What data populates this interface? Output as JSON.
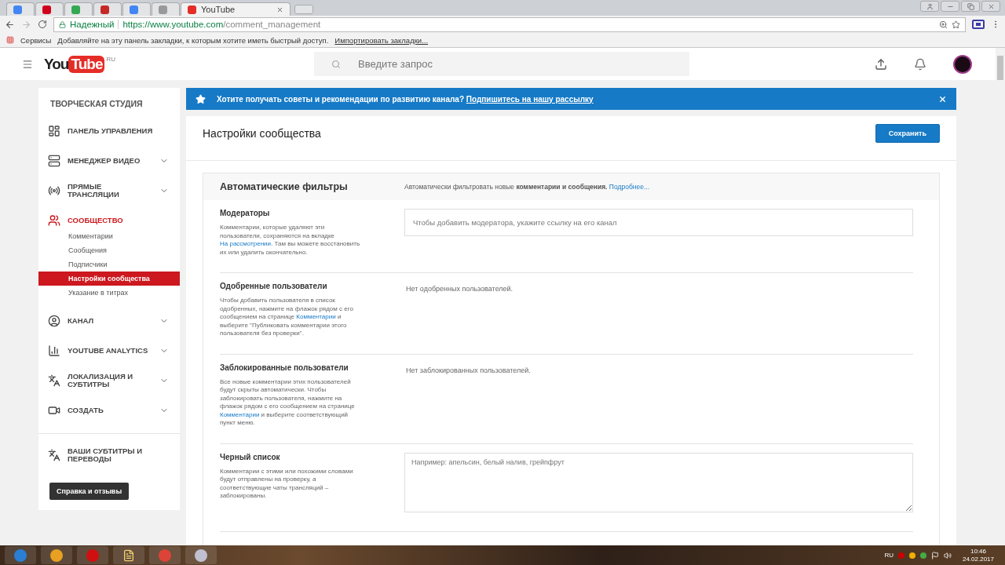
{
  "browser": {
    "tabs": [
      {
        "selected": false
      },
      {
        "selected": false
      },
      {
        "selected": false
      },
      {
        "selected": false
      },
      {
        "selected": false
      },
      {
        "selected": false
      },
      {
        "label": "YouTube",
        "selected": true
      }
    ],
    "address": {
      "secure_label": "Надежный",
      "url_host": "https://www.youtube.com",
      "url_path": "/comment_management"
    },
    "bookmarks": {
      "apps": "Сервисы",
      "hint": "Добавляйте на эту панель закладки, к которым хотите иметь быстрый доступ.",
      "link": "Импортировать закладки..."
    }
  },
  "header": {
    "logo_left": "You",
    "logo_right": "Tube",
    "region": "RU",
    "search_placeholder": "Введите запрос"
  },
  "sidebar": {
    "title": "ТВОРЧЕСКАЯ СТУДИЯ",
    "items": [
      {
        "label": "ПАНЕЛЬ УПРАВЛЕНИЯ",
        "expandable": false,
        "selected": false
      },
      {
        "label": "МЕНЕДЖЕР ВИДЕО",
        "expandable": true,
        "selected": false
      },
      {
        "label": "ПРЯМЫЕ ТРАНСЛЯЦИИ",
        "expandable": true,
        "selected": false
      },
      {
        "label": "СООБЩЕСТВО",
        "expandable": false,
        "selected": true,
        "children": [
          {
            "label": "Комментарии",
            "selected": false
          },
          {
            "label": "Сообщения",
            "selected": false
          },
          {
            "label": "Подписчики",
            "selected": false
          },
          {
            "label": "Настройки сообщества",
            "selected": true
          },
          {
            "label": "Указание в титрах",
            "selected": false
          }
        ]
      },
      {
        "label": "КАНАЛ",
        "expandable": true,
        "selected": false
      },
      {
        "label": "YOUTUBE ANALYTICS",
        "expandable": true,
        "selected": false
      },
      {
        "label": "ЛОКАЛИЗАЦИЯ И СУБТИТРЫ",
        "expandable": true,
        "selected": false
      },
      {
        "label": "СОЗДАТЬ",
        "expandable": true,
        "selected": false
      }
    ],
    "extra_item": "ВАШИ СУБТИТРЫ И ПЕРЕВОДЫ",
    "help_button": "Справка и отзывы"
  },
  "banner": {
    "text": "Хотите получать советы и рекомендации по развитию канала?",
    "link": "Подпишитесь на нашу рассылку"
  },
  "page": {
    "title": "Настройки сообщества",
    "save_button": "Сохранить"
  },
  "filters": {
    "title": "Автоматические фильтры",
    "description": "Автоматически фильтровать новые **комментарии и сообщения.**",
    "more_link": "Подробнее...",
    "sections": [
      {
        "kind": "field",
        "title": "Модераторы",
        "desc_before": "Комментарии, которые удаляют эти пользователи, сохраняются на вкладке",
        "link": "На рассмотрении",
        "desc_after": ". Там вы можете восстановить их или удалить окончательно.",
        "placeholder": "Чтобы добавить модератора, укажите ссылку на его канал"
      },
      {
        "kind": "empty",
        "title": "Одобренные пользователи",
        "desc_before": "Чтобы добавить пользователя в список одобренных, нажмите на флажок рядом с его сообщением на странице",
        "link": "Комментарии",
        "desc_after": " и выберите \"Публиковать комментарии этого пользователя без проверки\".",
        "value": "Нет одобренных пользователей."
      },
      {
        "kind": "empty",
        "title": "Заблокированные пользователи",
        "desc_before": "Все новые комментарии этих пользователей будут скрыты автоматически. Чтобы заблокировать пользователя, нажмите на флажок рядом с его сообщением на странице",
        "link": "Комментарии",
        "desc_after": " и выберите соответствующий пункт меню.",
        "value": "Нет заблокированных пользователей."
      },
      {
        "kind": "textarea",
        "title": "Черный список",
        "desc_before": "Комментарии с этими или похожими словами будут отправлены на проверку, а соответствующие чаты трансляций – заблокированы.",
        "placeholder": "Например: апельсин, белый налив, грейпфрут"
      }
    ]
  },
  "taskbar": {
    "language": "RU",
    "time": "10:46",
    "date": "24.02.2017"
  }
}
